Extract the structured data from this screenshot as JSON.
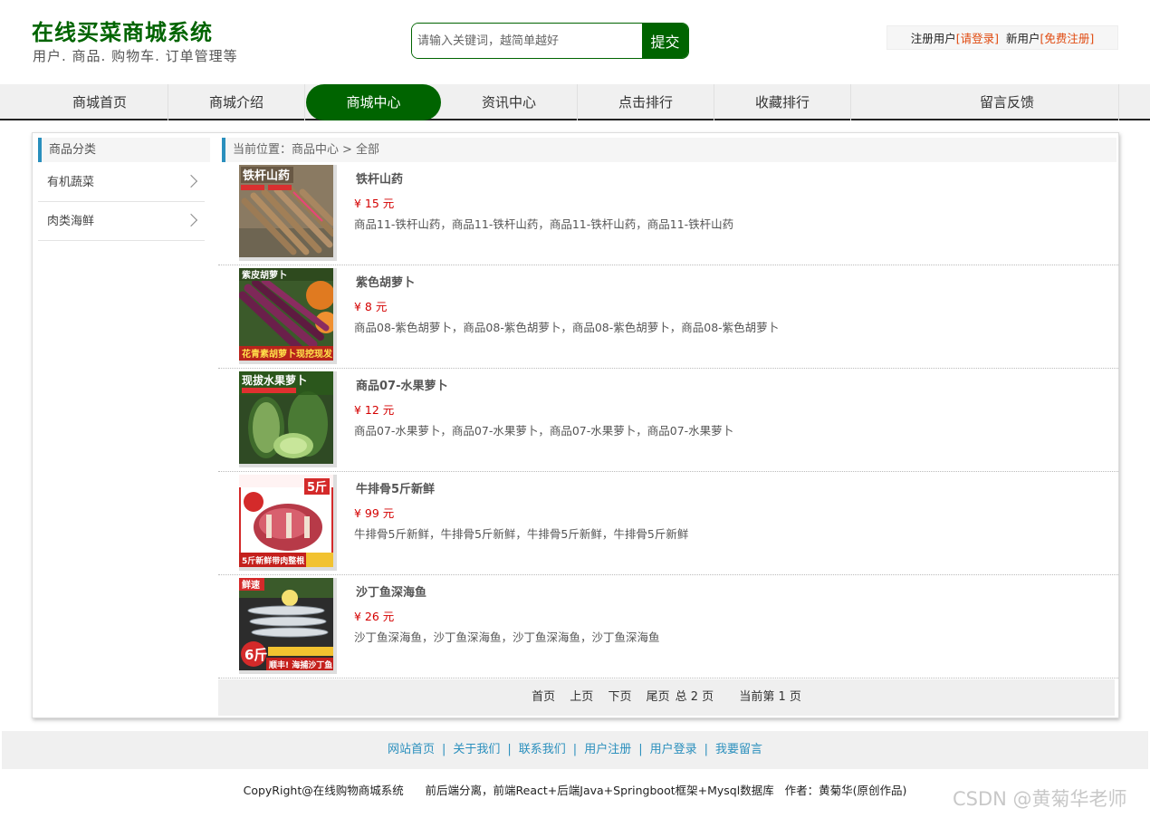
{
  "header": {
    "title": "在线买菜商城系统",
    "subtitle": "用户. 商品. 购物车. 订单管理等",
    "search_placeholder": "请输入关键词，越简单越好",
    "search_button": "提交",
    "registered_label": "注册用户",
    "login_link": "[请登录]",
    "new_user_label": "新用户",
    "register_link": "[免费注册]"
  },
  "nav": {
    "items": [
      "商城首页",
      "商城介绍",
      "商城中心",
      "资讯中心",
      "点击排行",
      "收藏排行",
      "留言反馈"
    ],
    "active_index": 2
  },
  "sidebar": {
    "title": "商品分类",
    "items": [
      "有机蔬菜",
      "肉类海鲜"
    ]
  },
  "breadcrumb": {
    "prefix": "当前位置：",
    "level1": "商品中心",
    "separator": ">",
    "level2": "全部"
  },
  "products": [
    {
      "name": "铁杆山药",
      "price": "¥ 15 元",
      "desc": "商品11-铁杆山药，商品11-铁杆山药，商品11-铁杆山药，商品11-铁杆山药",
      "image_text": "铁杆山药"
    },
    {
      "name": "紫色胡萝卜",
      "price": "¥ 8 元",
      "desc": "商品08-紫色胡萝卜，商品08-紫色胡萝卜，商品08-紫色胡萝卜，商品08-紫色胡萝卜",
      "image_text": "紫皮胡萝卜"
    },
    {
      "name": "商品07-水果萝卜",
      "price": "¥ 12 元",
      "desc": "商品07-水果萝卜，商品07-水果萝卜，商品07-水果萝卜，商品07-水果萝卜",
      "image_text": "现拔水果萝卜"
    },
    {
      "name": "牛排骨5斤新鲜",
      "price": "¥ 99 元",
      "desc": "牛排骨5斤新鲜，牛排骨5斤新鲜，牛排骨5斤新鲜，牛排骨5斤新鲜",
      "image_text": "5斤"
    },
    {
      "name": "沙丁鱼深海鱼",
      "price": "¥ 26 元",
      "desc": "沙丁鱼深海鱼，沙丁鱼深海鱼，沙丁鱼深海鱼，沙丁鱼深海鱼",
      "image_text": "6斤"
    }
  ],
  "pager": {
    "first": "首页",
    "prev": "上页",
    "next": "下页",
    "last": "尾页",
    "total": "总 2 页",
    "current": "当前第 1 页"
  },
  "footer": {
    "links": [
      "网站首页",
      "关于我们",
      "联系我们",
      "用户注册",
      "用户登录",
      "我要留言"
    ],
    "copyright": "CopyRight@在线购物商城系统      前后端分离，前端React+后端Java+Springboot框架+Mysql数据库   作者：黄菊华(原创作品)",
    "watermark": "CSDN @黄菊华老师"
  },
  "colors": {
    "brand_green": "#006400",
    "accent_blue": "#2a8fbd",
    "price_red": "#d40000",
    "link_orange": "#e04a10"
  }
}
